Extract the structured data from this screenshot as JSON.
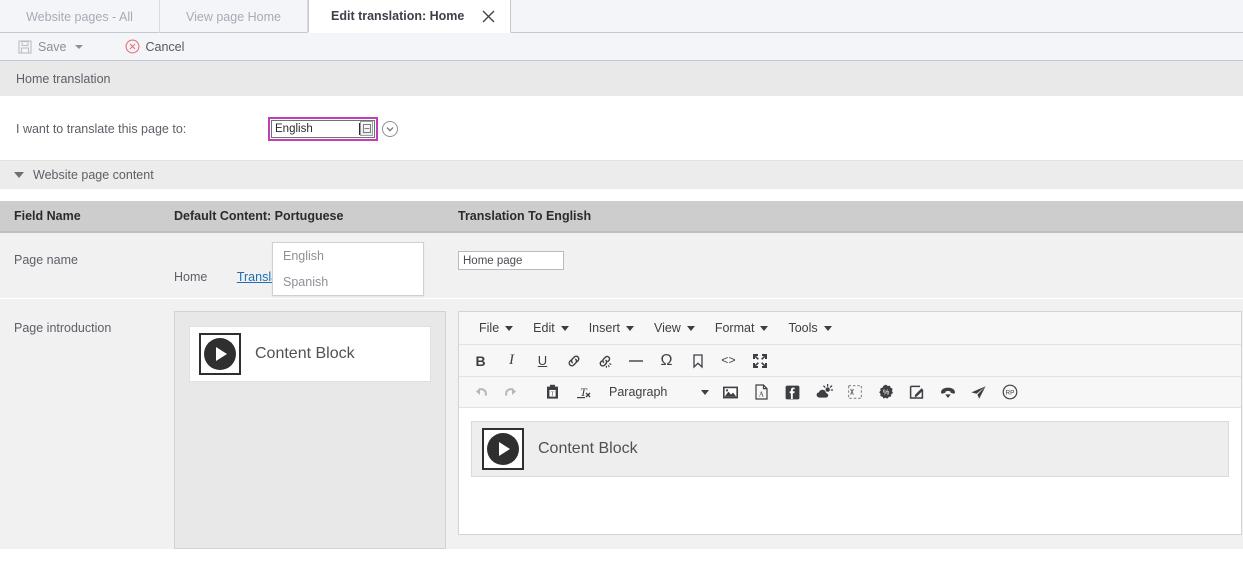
{
  "tabs": [
    {
      "label": "Website pages - All",
      "active": false
    },
    {
      "label": "View page Home",
      "active": false
    },
    {
      "label": "Edit translation: Home",
      "active": true
    }
  ],
  "tab_close_icon": "close-icon",
  "commandbar": {
    "save_label": "Save",
    "save_icon": "floppy-disk-icon",
    "save_caret_icon": "caret-down-icon",
    "cancel_label": "Cancel",
    "cancel_icon": "circle-x-icon"
  },
  "section": {
    "title": "Home translation"
  },
  "translate_to": {
    "label": "I want to translate this page to:",
    "value": "English",
    "placeholder": "",
    "spinner_icon": "spinner-stepper-icon",
    "dropdown_icon": "chevron-down-circle-icon",
    "focus_color": "#c13fb6",
    "options": [
      "English",
      "Spanish"
    ]
  },
  "accordion": {
    "label": "Website page content",
    "icon": "triangle-down-icon",
    "expanded": true
  },
  "table": {
    "headers": [
      "Field Name",
      "Default Content: Portuguese",
      "Translation To English"
    ],
    "rows": [
      {
        "field_name": "Page name",
        "default_content": "Home",
        "translate_link": "Translate",
        "translation_value": "Home page"
      },
      {
        "field_name": "Page introduction",
        "content_block_label": "Content Block",
        "content_block_icon": "play-circle-icon"
      }
    ]
  },
  "editor": {
    "menu": [
      {
        "label": "File",
        "icon": "caret-down-icon"
      },
      {
        "label": "Edit",
        "icon": "caret-down-icon"
      },
      {
        "label": "Insert",
        "icon": "caret-down-icon"
      },
      {
        "label": "View",
        "icon": "caret-down-icon"
      },
      {
        "label": "Format",
        "icon": "caret-down-icon"
      },
      {
        "label": "Tools",
        "icon": "caret-down-icon"
      }
    ],
    "toolbar_row1": [
      {
        "name": "bold-icon",
        "label": "B"
      },
      {
        "name": "italic-icon",
        "label": "I"
      },
      {
        "name": "underline-icon",
        "label": "U"
      },
      {
        "name": "link-icon",
        "label": ""
      },
      {
        "name": "unlink-icon",
        "label": ""
      },
      {
        "name": "horizontal-rule-icon",
        "label": ""
      },
      {
        "name": "special-character-icon",
        "label": "Ω"
      },
      {
        "name": "anchor-bookmark-icon",
        "label": ""
      },
      {
        "name": "source-code-icon",
        "label": "<>"
      },
      {
        "name": "fullscreen-icon",
        "label": ""
      }
    ],
    "toolbar_row2": [
      {
        "name": "undo-icon",
        "disabled": true
      },
      {
        "name": "redo-icon",
        "disabled": true
      },
      {
        "name": "paste-as-text-icon",
        "disabled": false
      },
      {
        "name": "clear-formatting-icon",
        "disabled": false
      }
    ],
    "format_select": {
      "value": "Paragraph",
      "icon": "caret-down-icon"
    },
    "toolbar_row2_right": [
      {
        "name": "image-icon"
      },
      {
        "name": "pdf-icon"
      },
      {
        "name": "facebook-icon"
      },
      {
        "name": "weather-icon"
      },
      {
        "name": "dashed-selection-icon"
      },
      {
        "name": "discount-percent-icon"
      },
      {
        "name": "edit-note-icon"
      },
      {
        "name": "phone-hangup-icon"
      },
      {
        "name": "send-paperplane-icon"
      },
      {
        "name": "rp-badge-icon"
      }
    ],
    "content_block_label": "Content Block",
    "content_block_icon": "play-circle-icon"
  }
}
